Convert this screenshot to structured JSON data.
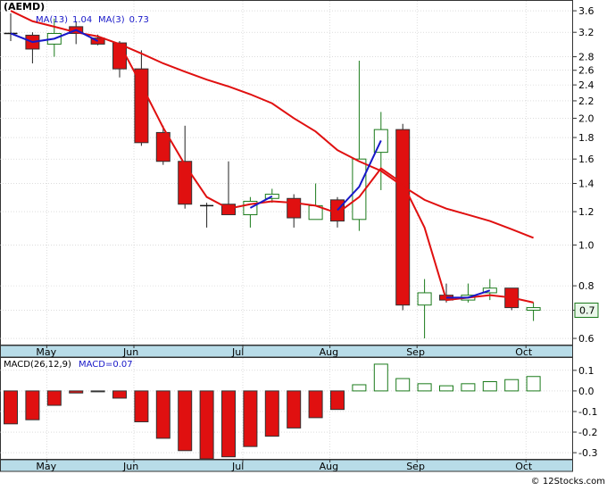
{
  "ticker": "(AEMD)",
  "watermark": "© 12Stocks.com",
  "colors": {
    "up_candle": "#1a7a1a",
    "down_candle": "#e01010",
    "ma_long": "#e01010",
    "ma_short": "#1818c8",
    "axis_band": "#b8dce8",
    "grid": "#c8c8c8",
    "price_tag_bg": "#eaf7ea"
  },
  "chart_data": [
    {
      "type": "candlestick",
      "title": "(AEMD)",
      "scale": "log",
      "ylim": [
        0.58,
        3.8
      ],
      "y_ticks": [
        0.6,
        0.7,
        0.8,
        1.0,
        1.2,
        1.4,
        1.6,
        1.8,
        2.0,
        2.2,
        2.4,
        2.6,
        2.8,
        3.2,
        3.6
      ],
      "y_tick_labels": [
        "0.6",
        "",
        "0.8",
        "1.0",
        "1.2",
        "1.4",
        "1.6",
        "1.8",
        "2.0",
        "2.2",
        "2.4",
        "2.6",
        "2.8",
        "3.2",
        "3.6"
      ],
      "x_labels": [
        "May",
        "Jun",
        "Jul",
        "Aug",
        "Sep",
        "Oct"
      ],
      "x_label_weeks": [
        1,
        5,
        10,
        14,
        18,
        23
      ],
      "last_price_label": "0.7",
      "last_price": 0.7,
      "grid": true,
      "legend": [
        {
          "label": "MA(13)",
          "value": "1.04",
          "color": "#1818c8"
        },
        {
          "label": "MA(3)",
          "value": "0.73",
          "color": "#1818c8"
        }
      ],
      "candles": [
        {
          "o": 3.18,
          "h": 3.55,
          "l": 3.05,
          "c": 3.18
        },
        {
          "o": 3.15,
          "h": 3.2,
          "l": 2.7,
          "c": 2.92
        },
        {
          "o": 3.0,
          "h": 3.45,
          "l": 2.8,
          "c": 3.18
        },
        {
          "o": 3.3,
          "h": 3.4,
          "l": 3.0,
          "c": 3.18
        },
        {
          "o": 3.1,
          "h": 3.16,
          "l": 2.98,
          "c": 3.0
        },
        {
          "o": 3.02,
          "h": 3.05,
          "l": 2.5,
          "c": 2.62
        },
        {
          "o": 2.62,
          "h": 2.9,
          "l": 1.72,
          "c": 1.75
        },
        {
          "o": 1.85,
          "h": 1.92,
          "l": 1.55,
          "c": 1.58
        },
        {
          "o": 1.58,
          "h": 1.92,
          "l": 1.22,
          "c": 1.25
        },
        {
          "o": 1.24,
          "h": 1.26,
          "l": 1.1,
          "c": 1.24
        },
        {
          "o": 1.25,
          "h": 1.58,
          "l": 1.18,
          "c": 1.18
        },
        {
          "o": 1.18,
          "h": 1.3,
          "l": 1.1,
          "c": 1.27
        },
        {
          "o": 1.29,
          "h": 1.36,
          "l": 1.26,
          "c": 1.32
        },
        {
          "o": 1.29,
          "h": 1.32,
          "l": 1.1,
          "c": 1.16
        },
        {
          "o": 1.15,
          "h": 1.4,
          "l": 1.15,
          "c": 1.24
        },
        {
          "o": 1.28,
          "h": 1.3,
          "l": 1.1,
          "c": 1.14
        },
        {
          "o": 1.15,
          "h": 2.74,
          "l": 1.08,
          "c": 1.6
        },
        {
          "o": 1.66,
          "h": 2.07,
          "l": 1.35,
          "c": 1.88
        },
        {
          "o": 1.88,
          "h": 1.94,
          "l": 0.7,
          "c": 0.72
        },
        {
          "o": 0.72,
          "h": 0.83,
          "l": 0.6,
          "c": 0.77
        },
        {
          "o": 0.76,
          "h": 0.81,
          "l": 0.73,
          "c": 0.74
        },
        {
          "o": 0.74,
          "h": 0.81,
          "l": 0.73,
          "c": 0.76
        },
        {
          "o": 0.77,
          "h": 0.83,
          "l": 0.74,
          "c": 0.79
        },
        {
          "o": 0.79,
          "h": 0.79,
          "l": 0.7,
          "c": 0.71
        },
        {
          "o": 0.7,
          "h": 0.73,
          "l": 0.66,
          "c": 0.71
        }
      ],
      "ma_long": {
        "color": "#e01010",
        "points": [
          [
            0,
            3.6
          ],
          [
            1,
            3.4
          ],
          [
            2,
            3.3
          ],
          [
            3,
            3.2
          ],
          [
            4,
            3.13
          ],
          [
            5,
            3.0
          ],
          [
            6,
            2.85
          ],
          [
            7,
            2.7
          ],
          [
            8,
            2.58
          ],
          [
            9,
            2.47
          ],
          [
            10,
            2.38
          ],
          [
            11,
            2.28
          ],
          [
            12,
            2.17
          ],
          [
            13,
            2.0
          ],
          [
            14,
            1.86
          ],
          [
            15,
            1.68
          ],
          [
            16,
            1.58
          ],
          [
            17,
            1.5
          ],
          [
            18,
            1.38
          ],
          [
            19,
            1.28
          ],
          [
            20,
            1.22
          ],
          [
            21,
            1.18
          ],
          [
            22,
            1.14
          ],
          [
            23,
            1.09
          ],
          [
            24,
            1.04
          ]
        ]
      },
      "ma_short": {
        "color": "#e01010",
        "points": [
          [
            5,
            3.0
          ],
          [
            6,
            2.4
          ],
          [
            7,
            1.9
          ],
          [
            8,
            1.55
          ],
          [
            9,
            1.3
          ],
          [
            10,
            1.22
          ],
          [
            11,
            1.25
          ],
          [
            12,
            1.27
          ],
          [
            13,
            1.26
          ],
          [
            14,
            1.24
          ],
          [
            15,
            1.19
          ],
          [
            16,
            1.3
          ],
          [
            17,
            1.52
          ],
          [
            18,
            1.4
          ],
          [
            19,
            1.1
          ],
          [
            20,
            0.74
          ],
          [
            21,
            0.75
          ],
          [
            22,
            0.76
          ],
          [
            23,
            0.75
          ],
          [
            24,
            0.73
          ]
        ],
        "blue_segments": [
          [
            0,
            4
          ],
          [
            11,
            12
          ],
          [
            15,
            17
          ],
          [
            20,
            22
          ]
        ]
      }
    },
    {
      "type": "bar",
      "title": "MACD(26,12,9)",
      "series_label": "MACD=0.07",
      "ylim": [
        -0.33,
        0.16
      ],
      "y_ticks": [
        0.1,
        0.0,
        -0.1,
        -0.2,
        -0.3
      ],
      "y_tick_labels": [
        "0.1",
        "0.0",
        "-0.1",
        "-0.2",
        "-0.3"
      ],
      "values": [
        -0.16,
        -0.14,
        -0.07,
        -0.01,
        0.0,
        -0.035,
        -0.15,
        -0.23,
        -0.29,
        -0.33,
        -0.32,
        -0.27,
        -0.22,
        -0.18,
        -0.13,
        -0.09,
        0.03,
        0.13,
        0.06,
        0.035,
        0.025,
        0.035,
        0.045,
        0.055,
        0.07
      ]
    }
  ]
}
